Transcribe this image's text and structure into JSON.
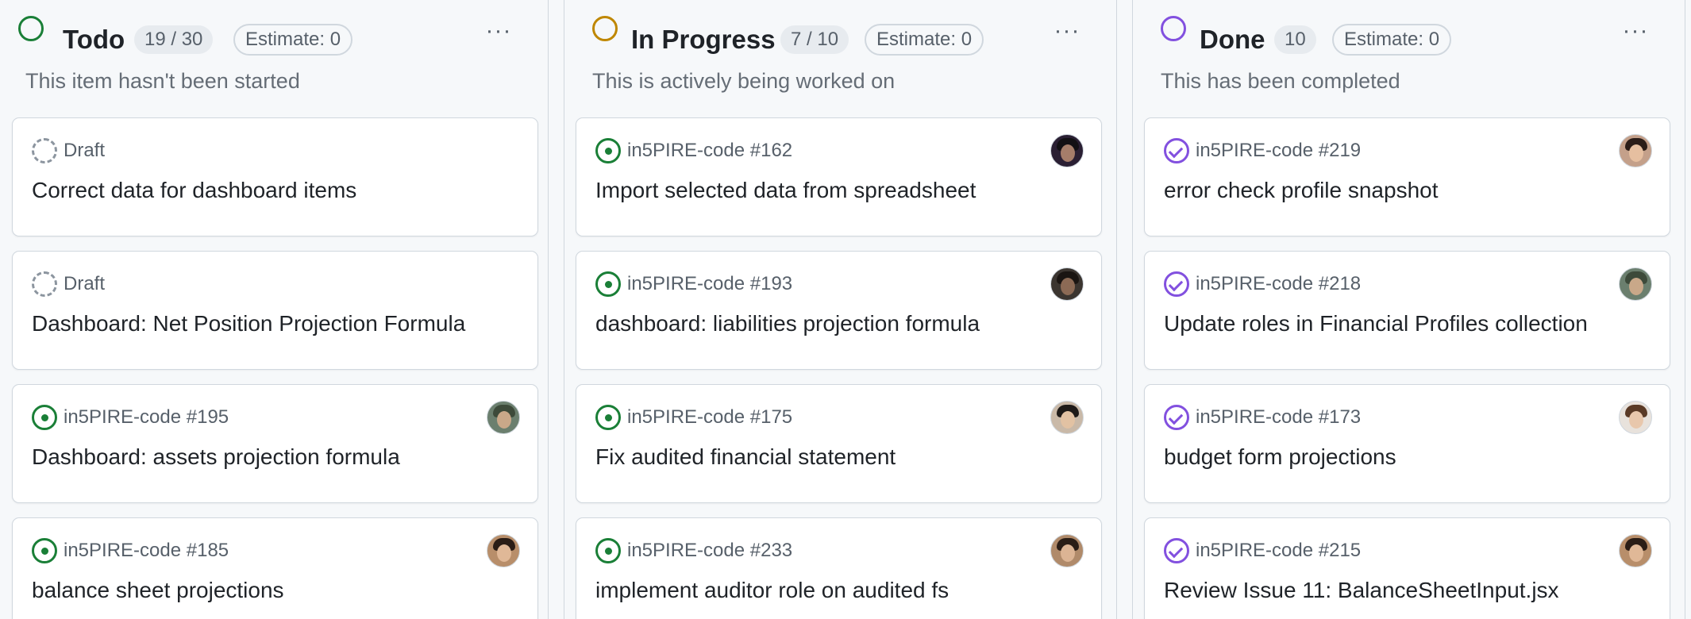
{
  "colors": {
    "todo": "#1a7f37",
    "in_progress": "#bf8700",
    "done": "#8250df",
    "draft": "#8c959f",
    "open_issue": "#1a7f37",
    "closed_issue": "#8250df"
  },
  "columns": [
    {
      "title": "Todo",
      "count": "19 / 30",
      "estimate": "Estimate: 0",
      "more": "···",
      "description": "This item hasn't been started",
      "cards": [
        {
          "type": "draft",
          "icon": "draft-icon",
          "ref": "Draft",
          "title": "Correct data for dashboard items",
          "avatar": null
        },
        {
          "type": "draft",
          "icon": "draft-icon",
          "ref": "Draft",
          "title": "Dashboard: Net Position Projection Formula",
          "avatar": null
        },
        {
          "type": "open",
          "icon": "issue-open-icon",
          "ref": "in5PIRE-code #195",
          "title": "Dashboard: assets projection formula",
          "avatar": "user-avatar"
        },
        {
          "type": "open",
          "icon": "issue-open-icon",
          "ref": "in5PIRE-code #185",
          "title": "balance sheet projections",
          "avatar": "user-avatar"
        }
      ]
    },
    {
      "title": "In Progress",
      "count": "7 / 10",
      "estimate": "Estimate: 0",
      "more": "···",
      "description": "This is actively being worked on",
      "cards": [
        {
          "type": "open",
          "icon": "issue-open-icon",
          "ref": "in5PIRE-code #162",
          "title": "Import selected data from spreadsheet",
          "avatar": "user-avatar"
        },
        {
          "type": "open",
          "icon": "issue-open-icon",
          "ref": "in5PIRE-code #193",
          "title": "dashboard: liabilities projection formula",
          "avatar": "user-avatar"
        },
        {
          "type": "open",
          "icon": "issue-open-icon",
          "ref": "in5PIRE-code #175",
          "title": "Fix audited financial statement",
          "avatar": "user-avatar"
        },
        {
          "type": "open",
          "icon": "issue-open-icon",
          "ref": "in5PIRE-code #233",
          "title": "implement auditor role on audited fs",
          "avatar": "user-avatar"
        }
      ]
    },
    {
      "title": "Done",
      "count": "10",
      "estimate": "Estimate: 0",
      "more": "···",
      "description": "This has been completed",
      "cards": [
        {
          "type": "done",
          "icon": "issue-closed-icon",
          "ref": "in5PIRE-code #219",
          "title": "error check profile snapshot",
          "avatar": "user-avatar"
        },
        {
          "type": "done",
          "icon": "issue-closed-icon",
          "ref": "in5PIRE-code #218",
          "title": "Update roles in Financial Profiles collection",
          "avatar": "user-avatar"
        },
        {
          "type": "done",
          "icon": "issue-closed-icon",
          "ref": "in5PIRE-code #173",
          "title": "budget form projections",
          "avatar": "user-avatar"
        },
        {
          "type": "done",
          "icon": "issue-closed-icon",
          "ref": "in5PIRE-code #215",
          "title": "Review Issue 11: BalanceSheetInput.jsx",
          "avatar": "user-avatar"
        }
      ]
    }
  ]
}
